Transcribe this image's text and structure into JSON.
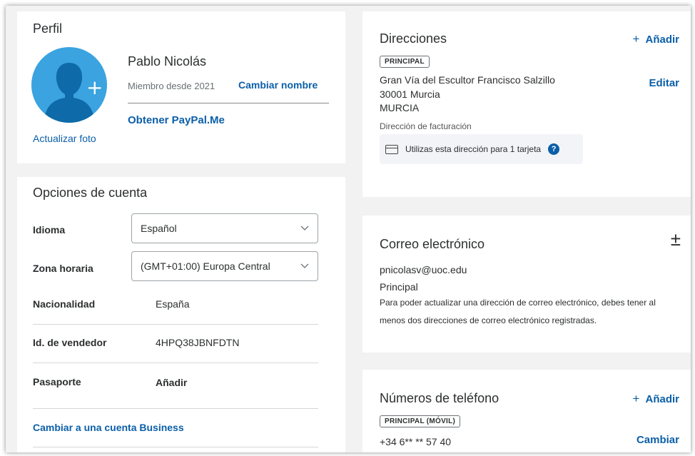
{
  "profile": {
    "title": "Perfil",
    "name": "Pablo Nicolás",
    "member_since": "Miembro desde 2021",
    "change_name": "Cambiar nombre",
    "paypal_me": "Obtener PayPal.Me",
    "update_photo": "Actualizar foto"
  },
  "account_options": {
    "title": "Opciones de cuenta",
    "language_label": "Idioma",
    "language_value": "Español",
    "timezone_label": "Zona horaria",
    "timezone_value": "(GMT+01:00) Europa Central",
    "nationality_label": "Nacionalidad",
    "nationality_value": "España",
    "seller_id_label": "Id. de vendedor",
    "seller_id_value": "4HPQ38JBNFDTN",
    "passport_label": "Pasaporte",
    "passport_action": "Añadir",
    "business_link": "Cambiar a una cuenta Business"
  },
  "addresses": {
    "title": "Direcciones",
    "add_label": "Añadir",
    "badge": "PRINCIPAL",
    "line1": "Gran Vía del Escultor Francisco Salzillo",
    "line2": "30001 Murcia",
    "line3": "MURCIA",
    "edit_label": "Editar",
    "billing_label": "Dirección de facturación",
    "card_usage": "Utilizas esta dirección para 1 tarjeta",
    "help_glyph": "?"
  },
  "email": {
    "title": "Correo electrónico",
    "toggle_glyph": "±",
    "address": "pnicolasv@uoc.edu",
    "status": "Principal",
    "note": "Para poder actualizar una dirección de correo electrónico, debes tener al menos dos direcciones de correo electrónico registradas."
  },
  "phones": {
    "title": "Números de teléfono",
    "add_label": "Añadir",
    "badge": "PRINCIPAL (MÓVIL)",
    "number": "+34 6** ** 57 40",
    "change_label": "Cambiar"
  },
  "colors": {
    "link": "#0b5fa8",
    "avatar_bg": "#3aa3e0",
    "avatar_figure": "#0e6aa8",
    "page_bg": "#f2f2f2"
  },
  "icons": [
    "plus-icon",
    "chevron-down-icon",
    "credit-card-icon",
    "help-icon",
    "plus-minus-icon",
    "avatar-icon"
  ]
}
